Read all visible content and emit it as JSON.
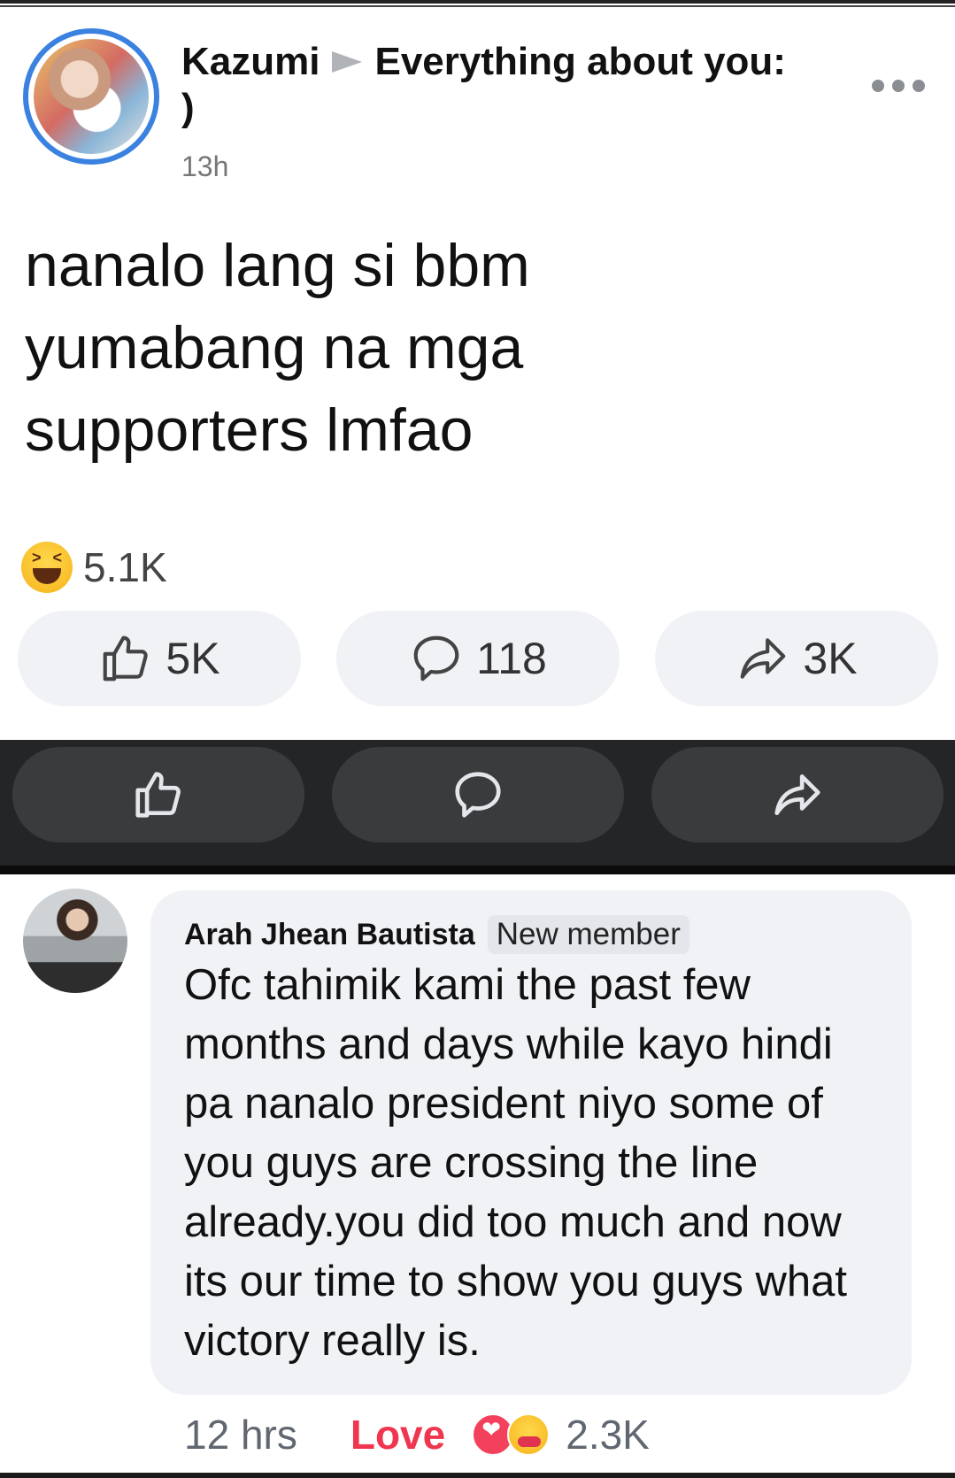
{
  "post": {
    "author": "Kazumi",
    "group": "Everything about you:",
    "group_suffix": ")",
    "time": "13h",
    "text_lines": [
      "nanalo lang si bbm",
      "yumabang na mga",
      "supporters lmfao"
    ],
    "reaction_count": "5.1K",
    "like_count": "5K",
    "comment_count": "118",
    "share_count": "3K",
    "icons": {
      "reaction": "haha-icon",
      "like": "thumbs-up-icon",
      "comment": "comment-icon",
      "share": "share-icon",
      "more": "more-options-icon"
    }
  },
  "comment": {
    "author": "Arah Jhean Bautista",
    "badge": "New member",
    "text_lines": [
      "Ofc tahimik kami the past few",
      "months and days while kayo hindi",
      "pa nanalo president niyo some of",
      "you guys are crossing the line",
      "already.you did too much and now",
      "its our time to show you guys what",
      "victory really is."
    ],
    "time": "12 hrs",
    "love_label": "Love",
    "reaction_count": "2.3K"
  },
  "colors": {
    "accent_blue": "#3b82e0",
    "love_red": "#f0354f",
    "dark_bar": "#242526",
    "pill_bg": "#f0f2f5"
  }
}
